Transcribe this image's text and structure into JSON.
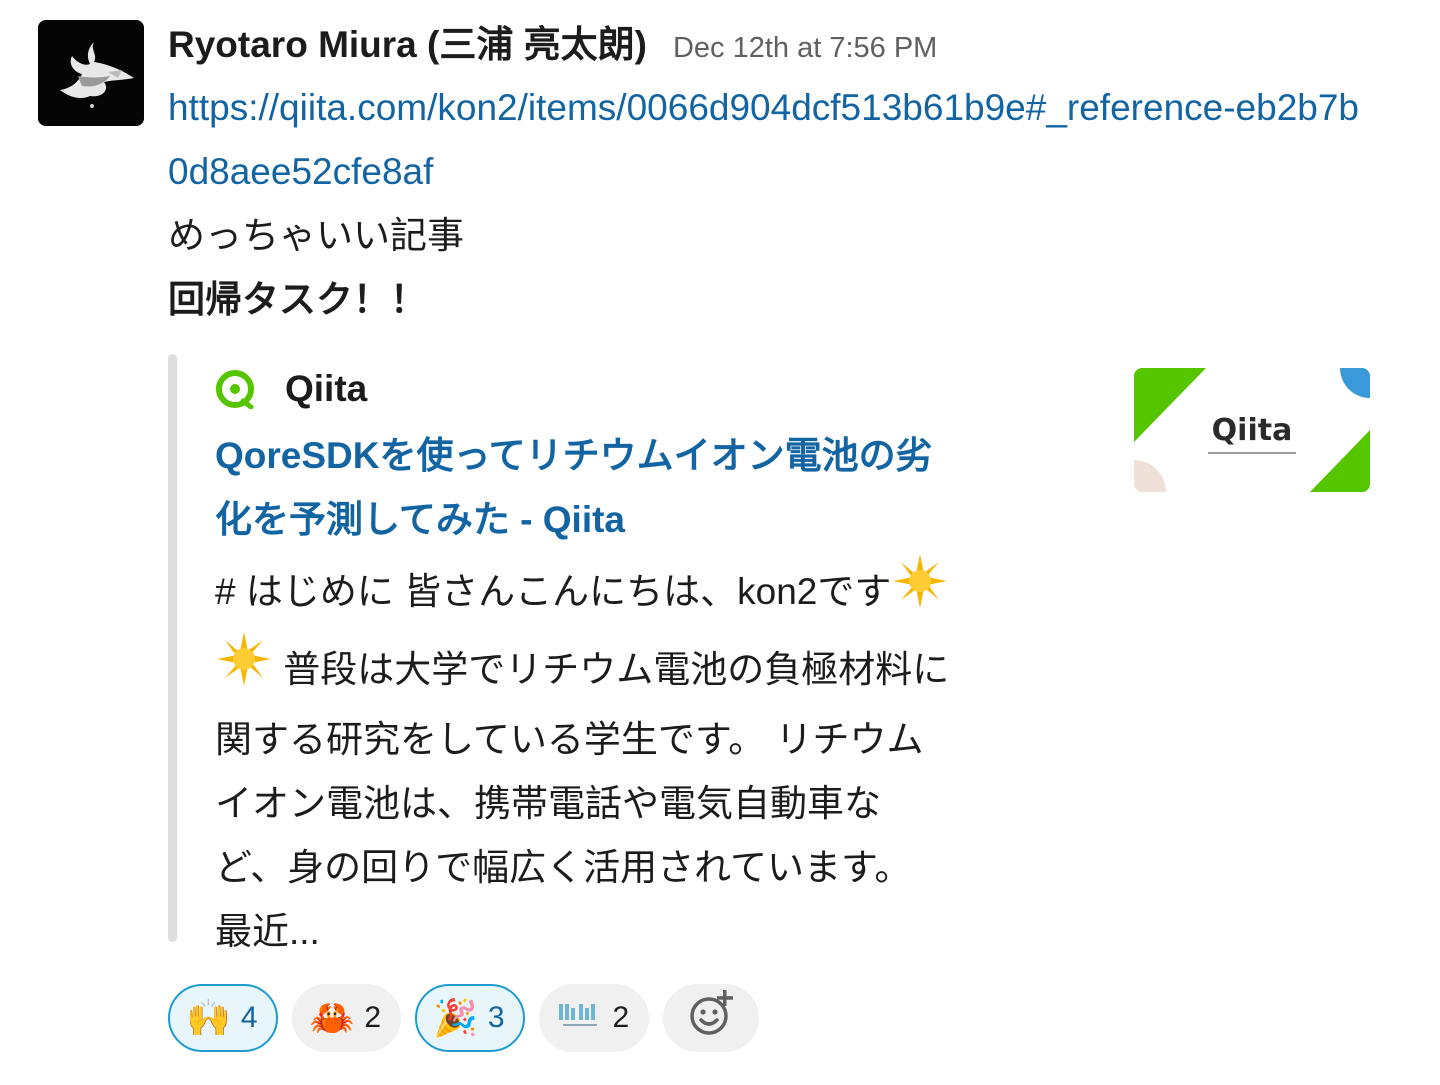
{
  "message": {
    "author": "Ryotaro Miura (三浦 亮太朗)",
    "timestamp": "Dec 12th at 7:56 PM",
    "link": "https://qiita.com/kon2/items/0066d904dcf513b61b9e#_reference-eb2b7b0d8aee52cfe8af",
    "text_lines": [
      "めっちゃいい記事",
      "回帰タスク！！"
    ]
  },
  "attachment": {
    "service_name": "Qiita",
    "title_line1": "QoreSDKを使ってリチウムイオン電池の劣",
    "title_line2": "化を予測してみた - Qiita",
    "desc_line1": "# はじめに 皆さんこんにちは、kon2です",
    "desc_line2": " 普段は大学でリチウム電池の負極材料に",
    "desc_line3": "関する研究をしている学生です。 リチウム",
    "desc_line4": "イオン電池は、携帯電話や電気自動車な",
    "desc_line5": "ど、身の回りで幅広く活用されています。",
    "desc_line6": "最近...",
    "thumbnail_logo": "Qiita",
    "colors": {
      "green": "#55c500",
      "blue": "#3a99d8",
      "beige": "#efe0d8"
    }
  },
  "reactions": [
    {
      "emoji": "🙌",
      "count": "4",
      "active": true,
      "icon": "raised-hands-icon"
    },
    {
      "emoji": "🦀",
      "count": "2",
      "active": false,
      "icon": "crab-icon"
    },
    {
      "emoji": "🎉",
      "count": "3",
      "active": true,
      "icon": "party-popper-icon"
    },
    {
      "emoji": "custom",
      "count": "2",
      "active": false,
      "icon": "custom-emoji-icon"
    }
  ],
  "add_reaction": {
    "icon": "add-reaction-icon"
  },
  "colors": {
    "link": "#1264a3",
    "active_border": "#1d9bd1",
    "active_bg": "#e8f5fa"
  }
}
